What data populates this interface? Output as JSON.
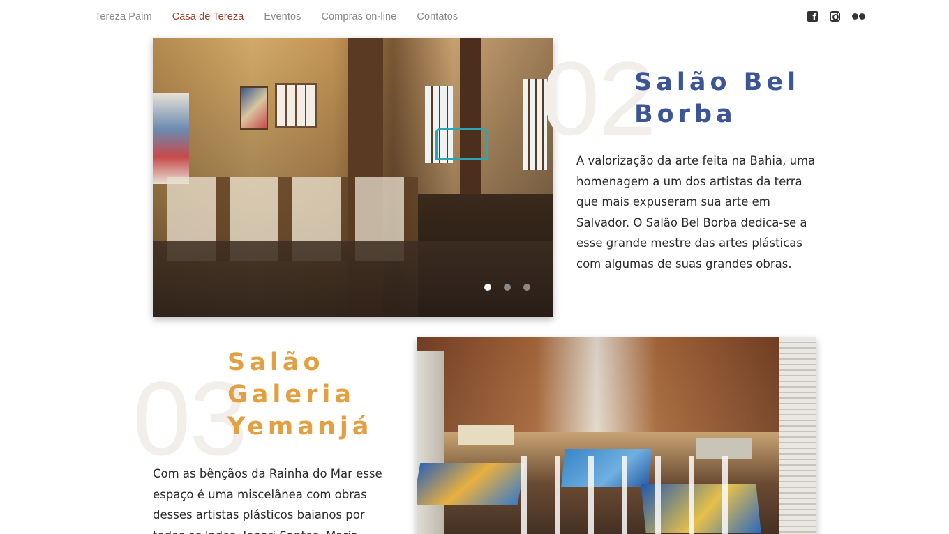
{
  "nav": {
    "links": [
      {
        "label": "Tereza Paim"
      },
      {
        "label": "Casa de Tereza",
        "active": true
      },
      {
        "label": "Eventos"
      },
      {
        "label": "Compras on-line"
      },
      {
        "label": "Contatos"
      }
    ],
    "social": [
      "facebook-icon",
      "instagram-icon",
      "flickr-icon"
    ]
  },
  "colors": {
    "active_nav": "#a0402a",
    "title_blue": "#3b5597",
    "title_orange": "#e3a042",
    "big_number": "#f2efea"
  },
  "section1": {
    "number": "02",
    "title_line1": "Salão Bel",
    "title_line2": "Borba",
    "description": "A valorização da arte feita na Bahia, uma homenagem a um dos artistas da terra que mais expuseram sua arte em Salvador. O Salão Bel Borba dedica-se a esse grande mestre das artes plásticas com algumas de suas grandes obras.",
    "carousel_active": 1,
    "carousel_total": 3
  },
  "section2": {
    "number": "03",
    "title_line1": "Salão",
    "title_line2": "Galeria",
    "title_line3": "Yemanjá",
    "description": "Com as bênçãos da Rainha do Mar esse espaço é uma miscelânea com obras desses artistas plásticos baianos por todos os lados. Jenari Santos, Maria"
  }
}
